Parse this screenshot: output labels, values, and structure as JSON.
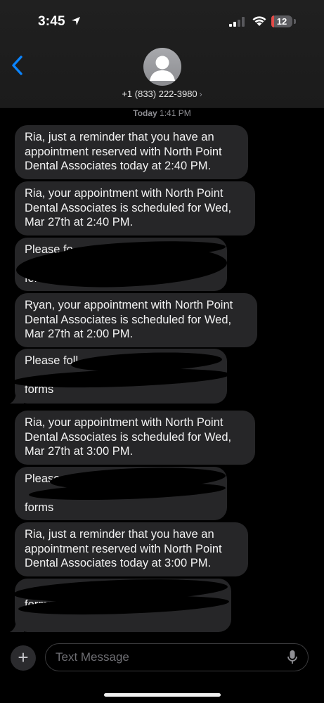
{
  "status": {
    "time": "3:45",
    "battery": "12"
  },
  "header": {
    "contact": "+1 (833) 222-3980",
    "chevron": "›"
  },
  "timestamp": {
    "day": "Today",
    "time": "1:41 PM"
  },
  "messages": [
    {
      "lines": [
        "Ria, just a reminder that you have an",
        "appointment reserved with North Point",
        "Dental Associates today at 2:40 PM."
      ]
    },
    {
      "lines": [
        "Ria, your appointment with North Point",
        "Dental Associates is scheduled for Wed,",
        "Mar 27th at 2:40 PM."
      ]
    },
    {
      "lines": [
        "Please fo",
        "",
        "form"
      ],
      "redacted": true
    },
    {
      "lines": [
        "Ryan, your appointment with North Point",
        "Dental Associates is scheduled for Wed,",
        "Mar 27th at 2:00 PM."
      ]
    },
    {
      "lines": [
        "Please foll",
        "",
        "forms"
      ],
      "redacted": true
    },
    {
      "lines": [
        "Ria, your appointment with North Point",
        "Dental Associates is scheduled for Wed,",
        "Mar 27th at 3:00 PM."
      ]
    },
    {
      "lines": [
        "Please",
        "",
        "forms"
      ],
      "redacted": true
    },
    {
      "lines": [
        "Ria, just a reminder that you have an",
        "appointment reserved with North Point",
        "Dental Associates today at 3:00 PM."
      ]
    },
    {
      "lines": [
        "",
        "",
        "forms"
      ],
      "redacted": true
    }
  ],
  "input": {
    "placeholder": "Text Message",
    "plus": "+"
  },
  "icons": [
    "location-arrow-icon",
    "cellular-signal-icon",
    "wifi-icon",
    "battery-icon",
    "back-chevron-icon",
    "contact-avatar-icon",
    "plus-icon",
    "microphone-icon"
  ],
  "colors": {
    "background": "#000000",
    "header": "#1e1e1e",
    "bubble": "#262628",
    "accent": "#0a84ff",
    "battery_low": "#e34b48"
  }
}
